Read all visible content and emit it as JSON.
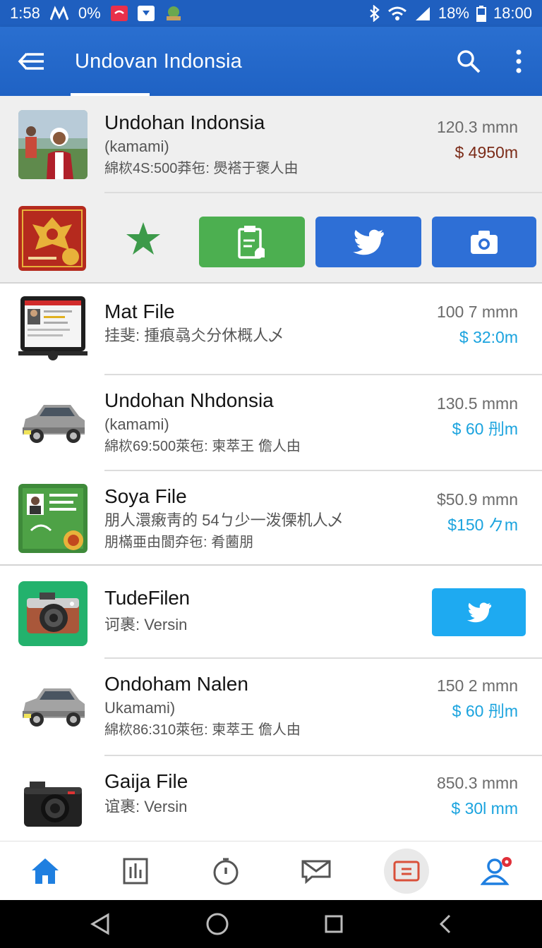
{
  "status_bar": {
    "time_left": "1:58",
    "extra_left": "0%",
    "battery": "18%",
    "time_right": "18:00"
  },
  "app_bar": {
    "title": "Undovan Indonsia"
  },
  "rows": [
    {
      "title": "Undohan Indonsia",
      "sub": "(kamami)",
      "sub2": "綿栨4S:500莽㐌: 爂褡于褒人由",
      "size": "120.3 mmn",
      "price": "$ 4950m"
    },
    {
      "title": "Mat File",
      "sub": "挂斐: 揰痕骉仌分休概人乄",
      "size": "100 7 mmn",
      "price": "$ 32:0m"
    },
    {
      "title": "Undohan Nhdonsia",
      "sub": "(kamami)",
      "sub2": "綿栨69:500萊㐌: 柬萃王 儋人由",
      "size": "130.5 mmn",
      "price": "$ 60 刐m"
    },
    {
      "title": "Soya File",
      "sub": "朋人澴瘷靑的 54ㄅ少一泼傈机人乄",
      "sub2": "朋樠亜由閬㚏㐌: 肴蔨朋",
      "size": "$50.9 mmn",
      "price": "$150 𠂊m"
    },
    {
      "title": "TudeFilen",
      "sub": "诃裹: Versin"
    },
    {
      "title": "Ondoham Nalen",
      "sub": "Ukamami)",
      "sub2": "綿栨86:310萊㐌: 柬萃王 儋人由",
      "size": "150 2 mmn",
      "price": "$ 60 刐m"
    },
    {
      "title": "Gaija File",
      "sub": "谊裹: Versin",
      "size": "850.3 mmn",
      "price": "$ 30l mm"
    }
  ],
  "colors": {
    "primary": "#2a6fd0",
    "green_button": "#4caf50",
    "blue_button": "#2e6fd6",
    "twitter_light": "#1eaaf1",
    "price_blue": "#1aa3de",
    "price_dark": "#7b2b18"
  },
  "icons": {
    "appbar": [
      "back-arrow-icon",
      "search-icon",
      "more-vert-icon"
    ],
    "actions": [
      "star-icon",
      "clipboard-icon",
      "twitter-icon",
      "camera-icon"
    ],
    "bottom_nav": [
      "home-icon",
      "chart-icon",
      "clock-icon",
      "mail-icon",
      "document-icon",
      "profile-icon"
    ]
  }
}
